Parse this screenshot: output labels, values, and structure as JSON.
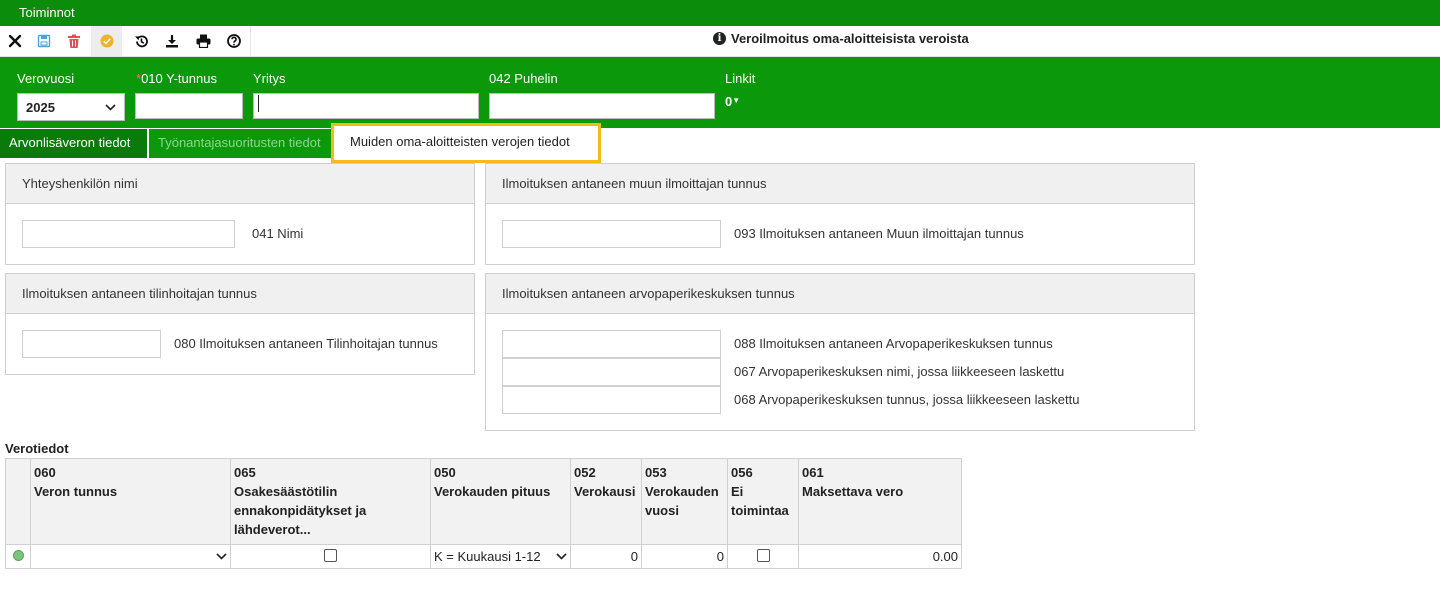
{
  "menu": {
    "label": "Toiminnot"
  },
  "toolbar": {
    "title": "Veroilmoitus oma-aloitteisista veroista",
    "icons": [
      "close-icon",
      "save-icon",
      "delete-icon",
      "approve-icon",
      "history-icon",
      "download-icon",
      "print-icon",
      "help-icon"
    ]
  },
  "header": {
    "verovuosi_label": "Verovuosi",
    "verovuosi_value": "2025",
    "ytunnus_required": "*",
    "ytunnus_label": "010 Y-tunnus",
    "ytunnus_value": "",
    "yritys_label": "Yritys",
    "yritys_value": "",
    "puhelin_label": "042 Puhelin",
    "puhelin_value": "",
    "linkit_label": "Linkit",
    "linkit_count": "0"
  },
  "tabs": [
    {
      "label": "Arvonlisäveron tiedot"
    },
    {
      "label": "Työnantajasuoritusten tiedot"
    },
    {
      "label": "Muiden oma-aloitteisten verojen tiedot"
    }
  ],
  "sections": {
    "contact": {
      "title": "Yhteyshenkilön nimi",
      "field_label": "041 Nimi",
      "value": ""
    },
    "other_reporter": {
      "title": "Ilmoituksen antaneen muun ilmoittajan tunnus",
      "field_label": "093 Ilmoituksen antaneen Muun ilmoittajan tunnus",
      "value": ""
    },
    "account_holder": {
      "title": "Ilmoituksen antaneen tilinhoitajan tunnus",
      "field_label": "080 Ilmoituksen antaneen Tilinhoitajan tunnus",
      "value": ""
    },
    "csd": {
      "title": "Ilmoituksen antaneen arvopaperikeskuksen tunnus",
      "fields": [
        {
          "label": "088 Ilmoituksen antaneen Arvopaperikeskuksen tunnus",
          "value": ""
        },
        {
          "label": "067 Arvopaperikeskuksen nimi, jossa liikkeeseen laskettu",
          "value": ""
        },
        {
          "label": "068 Arvopaperikeskuksen tunnus, jossa liikkeeseen laskettu",
          "value": ""
        }
      ]
    }
  },
  "verotiedot": {
    "title": "Verotiedot",
    "columns": [
      {
        "code": "060",
        "label": "Veron tunnus"
      },
      {
        "code": "065",
        "label": "Osakesäästötilin ennakonpidätykset ja lähdeverot..."
      },
      {
        "code": "050",
        "label": "Verokauden pituus"
      },
      {
        "code": "052",
        "label": "Verokausi"
      },
      {
        "code": "053",
        "label": "Verokauden vuosi"
      },
      {
        "code": "056",
        "label": "Ei toimintaa"
      },
      {
        "code": "061",
        "label": "Maksettava vero"
      }
    ],
    "row": {
      "veron_tunnus": "",
      "verokauden_pituus": "K = Kuukausi 1-12",
      "verokausi": "0",
      "verokauden_vuosi": "0",
      "maksettava_vero": "0.00"
    }
  }
}
